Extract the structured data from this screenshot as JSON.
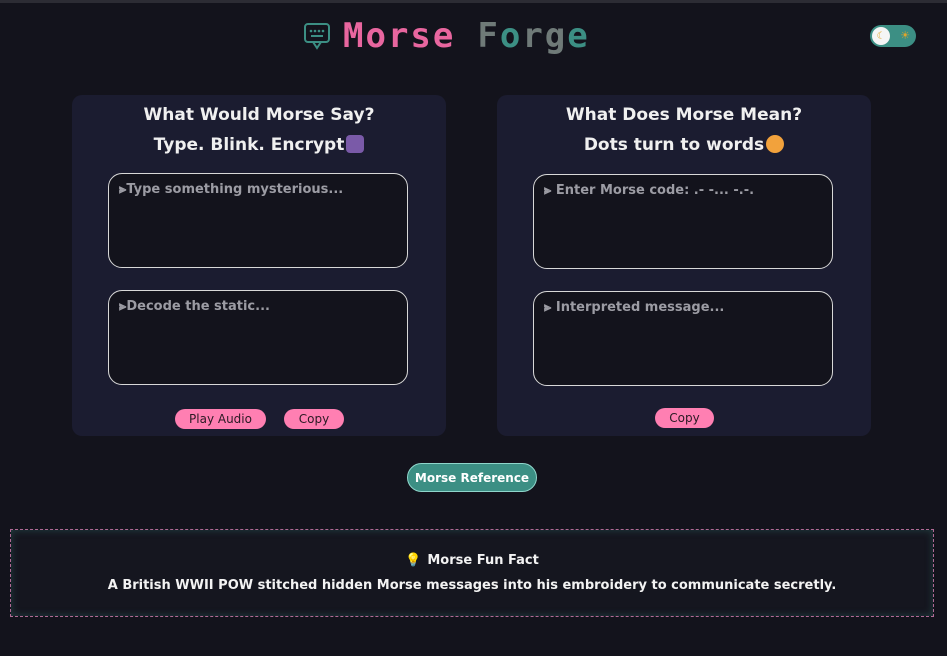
{
  "header": {
    "title_part1": "Morse",
    "title_part2_a": "F",
    "title_part2_b": "o",
    "title_part2_c": "rg",
    "title_part2_d": "e",
    "brand_pink": "#e8669f",
    "brand_teal": "#3c8f84"
  },
  "theme_toggle": {
    "moon_icon": "moon-icon",
    "sun_icon": "sun-icon"
  },
  "encoder": {
    "title_line1": "What Would Morse Say?",
    "title_line2": "Type. Blink. Encrypt",
    "emoji_icon": "wizard-icon",
    "input_placeholder": "⫸Type something mysterious...",
    "output_placeholder": "⫸Decode the static...",
    "play_audio_label": "Play Audio",
    "copy_label": "Copy"
  },
  "decoder": {
    "title_line1": "What Does Morse Mean?",
    "title_line2": "Dots turn to words",
    "emoji_icon": "flushed-face-icon",
    "input_placeholder": "⫸ Enter Morse code: .- -... -.-.",
    "output_placeholder": "⫸ Interpreted message...",
    "copy_label": "Copy"
  },
  "reference_button": "Morse Reference",
  "fun_fact": {
    "title": "Morse Fun Fact",
    "icon": "lightbulb-icon",
    "text": "A British WWII POW stitched hidden Morse messages into his embroidery to communicate secretly."
  }
}
